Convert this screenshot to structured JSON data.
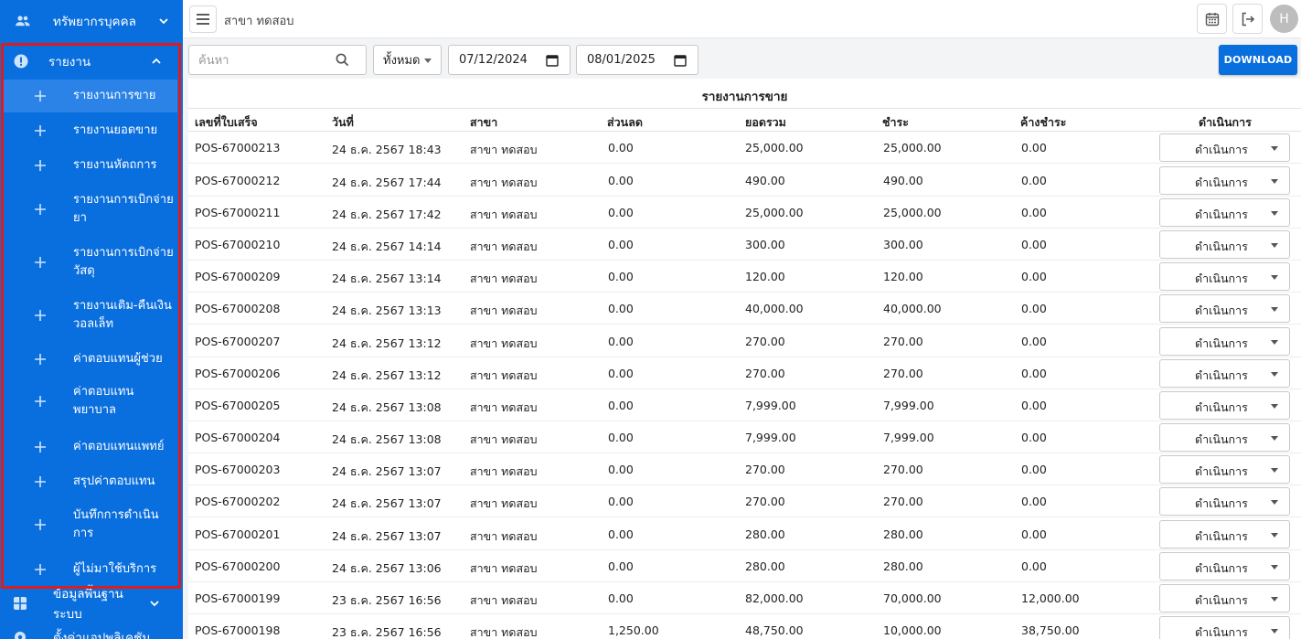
{
  "sidebar": {
    "top_item": {
      "label": "ทรัพยากรบุคคล"
    },
    "report_section": {
      "label": "รายงาน"
    },
    "report_items": [
      {
        "label": "รายงานการขาย",
        "active": true
      },
      {
        "label": "รายงานยอดขาย"
      },
      {
        "label": "รายงานหัตถการ"
      },
      {
        "label": "รายงานการเบิกจ่ายยา"
      },
      {
        "label": "รายงานการเบิกจ่ายวัสดุ"
      },
      {
        "label": "รายงานเติม-คืนเงินวอลเล็ท"
      },
      {
        "label": "ค่าตอบแทนผู้ช่วย"
      },
      {
        "label": "ค่าตอบแทนพยาบาล"
      },
      {
        "label": "ค่าตอบแทนแพทย์"
      },
      {
        "label": "สรุปค่าตอบแทน"
      },
      {
        "label": "บันทึกการดำเนินการ"
      },
      {
        "label": "ผู้ไม่มาใช้บริการ"
      }
    ],
    "bottom_items": [
      {
        "label": "ข้อมูลพื้นฐานระบบ"
      },
      {
        "label": "ตั้งค่าแอปพลิเคชัน"
      }
    ]
  },
  "header": {
    "branch": "สาขา ทดสอบ",
    "avatar_initial": "H"
  },
  "filters": {
    "search_placeholder": "ค้นหา",
    "status_select": "ทั้งหมด",
    "date_from": "07/12/2024",
    "date_to": "08/01/2025",
    "download_label": "DOWNLOAD"
  },
  "report": {
    "title": "รายงานการขาย",
    "columns": [
      "เลขที่ใบเสร็จ",
      "วันที่",
      "สาขา",
      "ส่วนลด",
      "ยอดรวม",
      "ชำระ",
      "ค้างชำระ",
      "ดำเนินการ"
    ],
    "action_label": "ดำเนินการ",
    "rows": [
      {
        "receipt": "POS-67000213",
        "date": "24 ธ.ค. 2567 18:43",
        "branch": "สาขา ทดสอบ",
        "discount": "0.00",
        "total": "25,000.00",
        "paid": "25,000.00",
        "outstanding": "0.00"
      },
      {
        "receipt": "POS-67000212",
        "date": "24 ธ.ค. 2567 17:44",
        "branch": "สาขา ทดสอบ",
        "discount": "0.00",
        "total": "490.00",
        "paid": "490.00",
        "outstanding": "0.00"
      },
      {
        "receipt": "POS-67000211",
        "date": "24 ธ.ค. 2567 17:42",
        "branch": "สาขา ทดสอบ",
        "discount": "0.00",
        "total": "25,000.00",
        "paid": "25,000.00",
        "outstanding": "0.00"
      },
      {
        "receipt": "POS-67000210",
        "date": "24 ธ.ค. 2567 14:14",
        "branch": "สาขา ทดสอบ",
        "discount": "0.00",
        "total": "300.00",
        "paid": "300.00",
        "outstanding": "0.00"
      },
      {
        "receipt": "POS-67000209",
        "date": "24 ธ.ค. 2567 13:14",
        "branch": "สาขา ทดสอบ",
        "discount": "0.00",
        "total": "120.00",
        "paid": "120.00",
        "outstanding": "0.00"
      },
      {
        "receipt": "POS-67000208",
        "date": "24 ธ.ค. 2567 13:13",
        "branch": "สาขา ทดสอบ",
        "discount": "0.00",
        "total": "40,000.00",
        "paid": "40,000.00",
        "outstanding": "0.00"
      },
      {
        "receipt": "POS-67000207",
        "date": "24 ธ.ค. 2567 13:12",
        "branch": "สาขา ทดสอบ",
        "discount": "0.00",
        "total": "270.00",
        "paid": "270.00",
        "outstanding": "0.00"
      },
      {
        "receipt": "POS-67000206",
        "date": "24 ธ.ค. 2567 13:12",
        "branch": "สาขา ทดสอบ",
        "discount": "0.00",
        "total": "270.00",
        "paid": "270.00",
        "outstanding": "0.00"
      },
      {
        "receipt": "POS-67000205",
        "date": "24 ธ.ค. 2567 13:08",
        "branch": "สาขา ทดสอบ",
        "discount": "0.00",
        "total": "7,999.00",
        "paid": "7,999.00",
        "outstanding": "0.00"
      },
      {
        "receipt": "POS-67000204",
        "date": "24 ธ.ค. 2567 13:08",
        "branch": "สาขา ทดสอบ",
        "discount": "0.00",
        "total": "7,999.00",
        "paid": "7,999.00",
        "outstanding": "0.00"
      },
      {
        "receipt": "POS-67000203",
        "date": "24 ธ.ค. 2567 13:07",
        "branch": "สาขา ทดสอบ",
        "discount": "0.00",
        "total": "270.00",
        "paid": "270.00",
        "outstanding": "0.00"
      },
      {
        "receipt": "POS-67000202",
        "date": "24 ธ.ค. 2567 13:07",
        "branch": "สาขา ทดสอบ",
        "discount": "0.00",
        "total": "270.00",
        "paid": "270.00",
        "outstanding": "0.00"
      },
      {
        "receipt": "POS-67000201",
        "date": "24 ธ.ค. 2567 13:07",
        "branch": "สาขา ทดสอบ",
        "discount": "0.00",
        "total": "280.00",
        "paid": "280.00",
        "outstanding": "0.00"
      },
      {
        "receipt": "POS-67000200",
        "date": "24 ธ.ค. 2567 13:06",
        "branch": "สาขา ทดสอบ",
        "discount": "0.00",
        "total": "280.00",
        "paid": "280.00",
        "outstanding": "0.00"
      },
      {
        "receipt": "POS-67000199",
        "date": "23 ธ.ค. 2567 16:56",
        "branch": "สาขา ทดสอบ",
        "discount": "0.00",
        "total": "82,000.00",
        "paid": "70,000.00",
        "outstanding": "12,000.00"
      },
      {
        "receipt": "POS-67000198",
        "date": "23 ธ.ค. 2567 16:56",
        "branch": "สาขา ทดสอบ",
        "discount": "1,250.00",
        "total": "48,750.00",
        "paid": "10,000.00",
        "outstanding": "38,750.00"
      }
    ]
  },
  "colors": {
    "sidebar_bg": "#0a6fde",
    "sidebar_active": "#2b83e8",
    "highlight_border": "#e01b1b",
    "download_button": "#0a6fde"
  }
}
